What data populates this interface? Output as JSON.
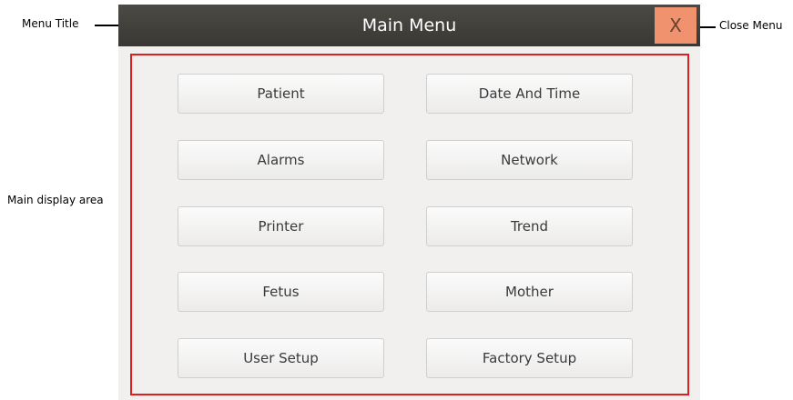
{
  "annotations": {
    "menu_title": "Menu Title",
    "close_menu": "Close Menu",
    "main_display_area": "Main display area"
  },
  "window": {
    "title": "Main Menu",
    "close_label": "X"
  },
  "menu": {
    "left": [
      "Patient",
      "Alarms",
      "Printer",
      "Fetus",
      "User Setup"
    ],
    "right": [
      "Date And Time",
      "Network",
      "Trend",
      "Mother",
      "Factory Setup"
    ]
  },
  "colors": {
    "titlebar": "#3f3d38",
    "close_button": "#f0926e",
    "display_border": "#e01e1e",
    "body": "#f1f0ee"
  }
}
